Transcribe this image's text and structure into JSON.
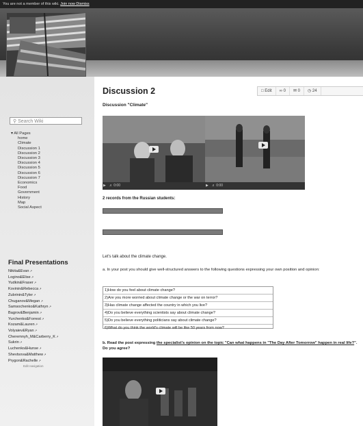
{
  "topbar": {
    "notice": "You are not a member of this wiki. ",
    "join_link": "Join now",
    "dismiss": " Dismiss"
  },
  "sidebar": {
    "search_placeholder": "Search Wiki",
    "pages_title": "All Pages",
    "pages": [
      "home",
      "Climate",
      "Discussion 1",
      "Discussion 2",
      "Discussion 3",
      "Discussion 4",
      "Discussion 5",
      "Discussion 6",
      "Discussion 7",
      "Economics",
      "Food",
      "Government",
      "History",
      "Map",
      "Social Aspect"
    ],
    "final_title": "Final Presentations",
    "final_items": [
      "Nikita&Evan",
      "Logino&Elise",
      "Yudkin&Fraser",
      "Kovinin&Rebecca",
      "Zubrinin&Tyler",
      "Chuganov&Megan",
      "Samsochenko&Kathryn",
      "Bagrov&Benjamin",
      "Yurchenko&Forrest",
      "Kozam&Lauren",
      "Volyaiev&Ryan",
      "Cheremnyh_M&Carberry_K",
      "Sukrin",
      "Luchenko&Hunse",
      "Shevtsova&Matthew",
      "Prygon&Rachelle"
    ],
    "edit_nav": "Edit navigation"
  },
  "main": {
    "title": "Discussion 2",
    "toolbar": {
      "edit": "Edit",
      "count1": "0",
      "count2": "0",
      "count3": "24"
    },
    "subtitle": "Discussion \"Climate\"",
    "video1": {
      "time": "0:00"
    },
    "video2": {
      "time": "0:00"
    },
    "records_label": "2 records from the Russian students:",
    "climate_intro": "Let's talk about the climate change.",
    "task_a": "a. In your post you should give well-structured answers to the following questions expressing your own position and opinion:",
    "questions": [
      "1)How do you feel about climate change?",
      "2)Are you more worried about climate change or the war on terror?",
      "3)Has climate change affected the country in which you live?",
      "4)Do you believe everything scientists say about climate change?",
      "5)Do you believe everything politicians say about climate change?",
      "6)What do you think the world's climate will be like 50 years from now?"
    ],
    "task_b_pre": "b. Read the post expressing ",
    "task_b_link": "the specialist's opinion on the topic \"Can what happens in \"The Day After Tomorrow\" happen in real life?",
    "task_b_post": "\". Do you agree?"
  }
}
